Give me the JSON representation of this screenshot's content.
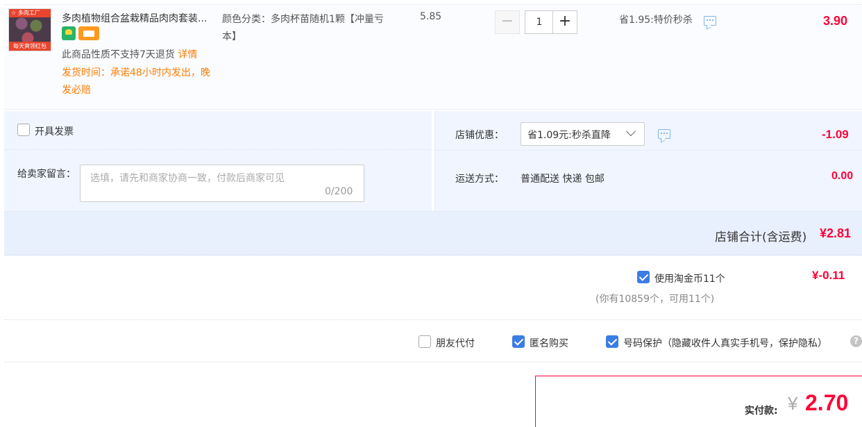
{
  "item": {
    "thumb_top_text": "☆ 多肉工厂",
    "thumb_bottom_text": "每天爽领红包",
    "title": "多肉植物组合盆栽精品肉肉套装...",
    "no_return": "此商品性质不支持7天退货",
    "no_return_link": "详情",
    "ship_time": "发货时间：承诺48小时内发出，晚发必赔",
    "sku": "颜色分类：多肉杯苗随机1颗【冲量亏本】",
    "unit_price": "5.85",
    "qty_minus": "−",
    "qty": "1",
    "qty_plus": "+",
    "promo": "省1.95:特价秒杀",
    "total": "3.90"
  },
  "invoice_label": "开具发票",
  "message": {
    "label": "给卖家留言：",
    "placeholder": "选填，请先和商家协商一致，付款后商家可见",
    "count": "0/200"
  },
  "shop_discount": {
    "label": "店铺优惠：",
    "value": "省1.09元:秒杀直降",
    "amount": "-1.09"
  },
  "shipping": {
    "label": "运送方式：",
    "value": "普通配送 快递 包邮",
    "amount": "0.00"
  },
  "shop_total": {
    "label": "店铺合计(含运费)",
    "amount": "¥2.81"
  },
  "coins": {
    "label": "使用淘金币11个",
    "amount": "¥-0.11",
    "hint": "(你有10859个，可用11个)",
    "checked": true
  },
  "options": {
    "friend_pay": "朋友代付",
    "anonymous": "匿名购买",
    "privacy": "号码保护（隐藏收件人真实手机号，保护隐私）",
    "help": "?"
  },
  "pay": {
    "label": "实付款:",
    "currency": "¥",
    "amount": "2.70"
  },
  "colors": {
    "accent_red": "#ff0036",
    "checkbox_blue": "#3c7ce5",
    "warning_orange": "#ff7b00"
  }
}
